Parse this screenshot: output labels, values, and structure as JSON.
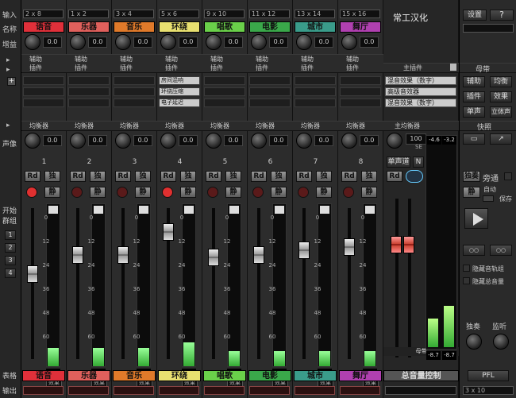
{
  "left_labels": {
    "input": "输入",
    "name": "名称",
    "gain": "增益",
    "insert": "插件",
    "pan": "声像",
    "start": "开始",
    "group": "群组",
    "track_name": "表格",
    "output": "输出"
  },
  "group_buttons": [
    "1",
    "2",
    "3",
    "4"
  ],
  "strips": [
    {
      "io": "2 x 8",
      "name": "语音",
      "color": "#e0303a",
      "gain": "0.0",
      "send_a": "辅助",
      "send_b": "插件",
      "eq": "均衡器",
      "pan": "0.0",
      "number": "1",
      "readout": "-10.9",
      "meter": 0.12,
      "fader": 0.55,
      "rec": true,
      "rec_color": "#e03030",
      "fx": [
        "",
        "",
        ""
      ],
      "bottom": "效果"
    },
    {
      "io": "1 x 2",
      "name": "乐器",
      "color": "#e0605c",
      "gain": "0.0",
      "send_a": "辅助",
      "send_b": "插件",
      "eq": "均衡器",
      "pan": "0.0",
      "number": "2",
      "readout": "-3.5",
      "meter": 0.12,
      "fader": 0.7,
      "rec": false,
      "rec_color": "#5a1a1a",
      "fx": [
        "",
        "",
        ""
      ],
      "bottom": "效果"
    },
    {
      "io": "3 x 4",
      "name": "音乐",
      "color": "#e07a2a",
      "gain": "0.0",
      "send_a": "辅助",
      "send_b": "插件",
      "eq": "均衡器",
      "pan": "0.0",
      "number": "3",
      "readout": "-3.2",
      "meter": 0.12,
      "fader": 0.7,
      "rec": false,
      "rec_color": "#5a1a1a",
      "fx": [
        "",
        "",
        ""
      ],
      "bottom": "效果"
    },
    {
      "io": "5 x 6",
      "name": "环绕",
      "color": "#e8e070",
      "gain": "0.0",
      "send_a": "辅助",
      "send_b": "插件",
      "eq": "均衡器",
      "pan": "0.0",
      "number": "4",
      "readout": "6.7",
      "meter": 0.16,
      "fader": 0.88,
      "rec": true,
      "rec_color": "#e03030",
      "fx": [
        "房间混响",
        "环绕压缩",
        "电子延迟"
      ],
      "bottom": "效果"
    },
    {
      "io": "9 x 10",
      "name": "唱歌",
      "color": "#6ad04a",
      "gain": "0.0",
      "send_a": "辅助",
      "send_b": "插件",
      "eq": "均衡器",
      "pan": "0.0",
      "number": "5",
      "readout": "-2.5",
      "meter": 0.1,
      "fader": 0.68,
      "rec": false,
      "rec_color": "#5a1a1a",
      "fx": [
        "",
        "",
        ""
      ],
      "bottom": "效果"
    },
    {
      "io": "11 x 12",
      "name": "电影",
      "color": "#3aa84a",
      "gain": "0.0",
      "send_a": "辅助",
      "send_b": "插件",
      "eq": "均衡器",
      "pan": "0.0",
      "number": "6",
      "readout": "-1.9",
      "meter": 0.1,
      "fader": 0.7,
      "rec": false,
      "rec_color": "#5a1a1a",
      "fx": [
        "",
        "",
        ""
      ],
      "bottom": "效果"
    },
    {
      "io": "13 x 14",
      "name": "城市",
      "color": "#3a9c8a",
      "gain": "0.0",
      "send_a": "辅助",
      "send_b": "插件",
      "eq": "均衡器",
      "pan": "0.0",
      "number": "7",
      "readout": "0.9",
      "meter": 0.1,
      "fader": 0.74,
      "rec": false,
      "rec_color": "#5a1a1a",
      "fx": [
        "",
        "",
        ""
      ],
      "bottom": "效果"
    },
    {
      "io": "15 x 16",
      "name": "舞厅",
      "color": "#b040b0",
      "gain": "0.0",
      "send_a": "辅助",
      "send_b": "插件",
      "eq": "均衡器",
      "pan": "0.0",
      "number": "8",
      "readout": "2.2",
      "meter": 0.1,
      "fader": 0.76,
      "rec": false,
      "rec_color": "#5a1a1a",
      "fx": [
        "",
        "",
        ""
      ],
      "bottom": "效果"
    }
  ],
  "master": {
    "title": "常工汉化",
    "settings": "设置",
    "pan_label": "主插件",
    "eq": "主均衡器",
    "pan": "100",
    "pan_sub": "SE",
    "phase": "单声道",
    "n_btn": "N",
    "readouts": [
      "-4.6",
      "-3.2"
    ],
    "bottom_readouts": [
      "-8.7",
      "-8.7"
    ],
    "name": "总音量控制",
    "fader": 0.6
  },
  "master_fx": [
    "混音效果（数字）",
    "高级音效器",
    "混音效果（数字）"
  ],
  "right_panel": {
    "labels": {
      "row1": [
        "辅助",
        "均衡"
      ],
      "row2": [
        "插件",
        "效果"
      ],
      "row3": [
        "单声",
        "立体声"
      ],
      "quick": "快照",
      "solo": "独奏",
      "send": "旁通",
      "mute": "静",
      "auto": "自动",
      "latch": "保存",
      "monitor_a": "独奏",
      "monitor_b": "监听",
      "check1": "隐藏音轨组",
      "check2": "隐藏总音量",
      "pfl": "PFL",
      "out": "3 x 10",
      "bus": "母带"
    }
  },
  "strip_buttons": {
    "rd": "Rd",
    "solo": "独",
    "mute": "静"
  },
  "scale_marks": [
    "0",
    "12",
    "24",
    "36",
    "48",
    "60"
  ]
}
